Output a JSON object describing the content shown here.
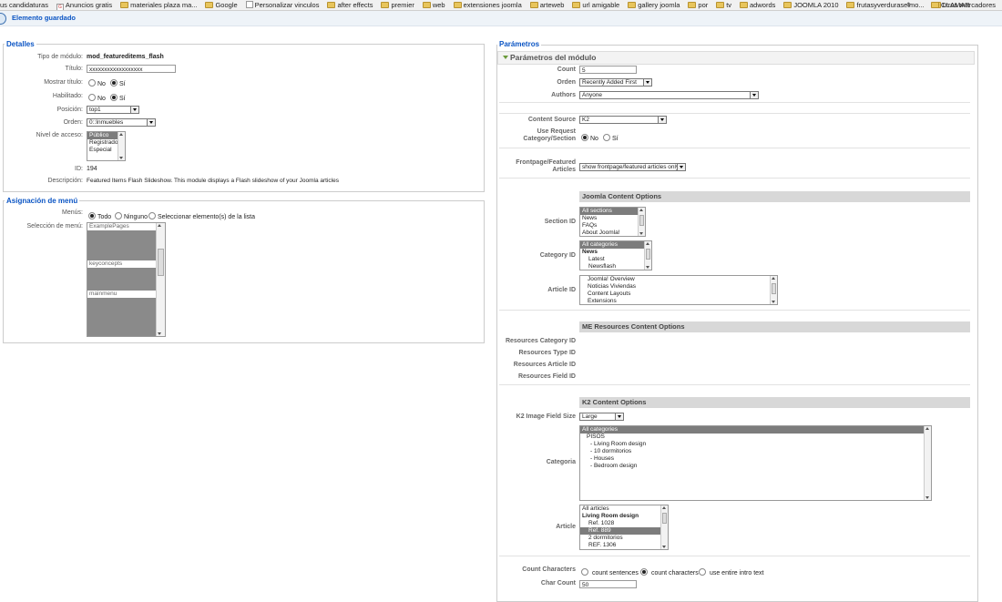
{
  "bookmarks": {
    "items": [
      {
        "label": "us candidaturas",
        "icon": "none"
      },
      {
        "label": "Anuncios gratis",
        "icon": "g-icon"
      },
      {
        "label": "materiales plaza ma...",
        "icon": "folder-icon"
      },
      {
        "label": "Google",
        "icon": "folder-icon"
      },
      {
        "label": "Personalizar vinculos",
        "icon": "page-icon"
      },
      {
        "label": "after effects",
        "icon": "folder-icon"
      },
      {
        "label": "premier",
        "icon": "folder-icon"
      },
      {
        "label": "web",
        "icon": "folder-icon"
      },
      {
        "label": "extensiones joomla",
        "icon": "folder-icon"
      },
      {
        "label": "arteweb",
        "icon": "folder-icon"
      },
      {
        "label": "url amigable",
        "icon": "folder-icon"
      },
      {
        "label": "gallery joomla",
        "icon": "folder-icon"
      },
      {
        "label": "por",
        "icon": "folder-icon"
      },
      {
        "label": "tv",
        "icon": "folder-icon"
      },
      {
        "label": "adwords",
        "icon": "folder-icon"
      },
      {
        "label": "JOOMLA 2010",
        "icon": "folder-icon"
      },
      {
        "label": "frutasyverduraselmo...",
        "icon": "folder-icon"
      },
      {
        "label": "LLAMAR",
        "icon": "folder-icon"
      }
    ],
    "more": "»",
    "other": "Otros marcadores"
  },
  "message": "Elemento guardado",
  "details": {
    "title": "Detalles",
    "tipo_label": "Tipo de módulo:",
    "tipo_value": "mod_featureditems_flash",
    "titulo_label": "Título:",
    "titulo_value": "xxxxxxxxxxxxxxxxxx",
    "mostrar_label": "Mostrar título:",
    "habilitado_label": "Habilitado:",
    "no": "No",
    "si": "Sí",
    "posicion_label": "Posición:",
    "posicion_value": "top1",
    "orden_label": "Orden:",
    "orden_value": "0::Inmuebles",
    "nivel_label": "Nivel de acceso:",
    "nivel_options": [
      "Público",
      "Registrado",
      "Especial"
    ],
    "id_label": "ID:",
    "id_value": "194",
    "desc_label": "Descripción:",
    "desc_value": "Featured Items Flash Slideshow. This module displays a Flash slideshow of your Joomla articles"
  },
  "menu": {
    "title": "Asignación de menú",
    "menus_label": "Menús:",
    "opt_todo": "Todo",
    "opt_ninguno": "Ninguno",
    "opt_select": "Seleccionar elemento(s) de la lista",
    "seleccion_label": "Selección de menú:",
    "list": [
      "ExamplePages",
      "keyconcepts",
      "mainmenu"
    ]
  },
  "params": {
    "title": "Parámetros",
    "section_title": "Parámetros del módulo",
    "count_label": "Count",
    "count_value": "5",
    "orden_label": "Orden",
    "orden_value": "Recently Added First",
    "authors_label": "Authors",
    "authors_value": "Anyone",
    "source_label": "Content Source",
    "source_value": "K2",
    "userequest_label": "Use Request Category/Section",
    "no": "No",
    "si": "Sí",
    "frontpage_label": "Frontpage/Featured Articles",
    "frontpage_value": "show frontpage/featured articles only",
    "joomla_head": "Joomla Content Options",
    "section_id_label": "Section ID",
    "section_options": [
      "All sections",
      "News",
      "FAQs",
      "About Joomla!"
    ],
    "category_id_label": "Category ID",
    "category_options": [
      "All categories",
      "News",
      "Latest",
      "Newsflash"
    ],
    "article_id_label": "Article ID",
    "article_options": [
      "Joomla! Overview",
      "Noticias Viviendas",
      "Content Layouts",
      "Extensions"
    ],
    "me_head": "ME Resources Content Options",
    "res_cat_label": "Resources Category ID",
    "res_type_label": "Resources Type ID",
    "res_article_label": "Resources Article ID",
    "res_field_label": "Resources Field ID",
    "k2_head": "K2 Content Options",
    "k2_size_label": "K2 Image Field Size",
    "k2_size_value": "Large",
    "categoria_label": "Categoria",
    "categoria_options": [
      "All categories",
      "PISOS",
      "- Living Room design",
      "- 10 dormitorios",
      "- Houses",
      "- Bedroom design"
    ],
    "article_label": "Article",
    "article_list": [
      "All articles",
      "Living Room design",
      "Ref. 1028",
      "Ref. 889",
      "2 dormitorios",
      "REF. 1306"
    ],
    "count_chars_label": "Count Characters",
    "cc_sentences": "count sentences",
    "cc_characters": "count characters",
    "cc_intro": "use entire intro text",
    "char_count_label": "Char Count",
    "char_count_value": "50"
  }
}
